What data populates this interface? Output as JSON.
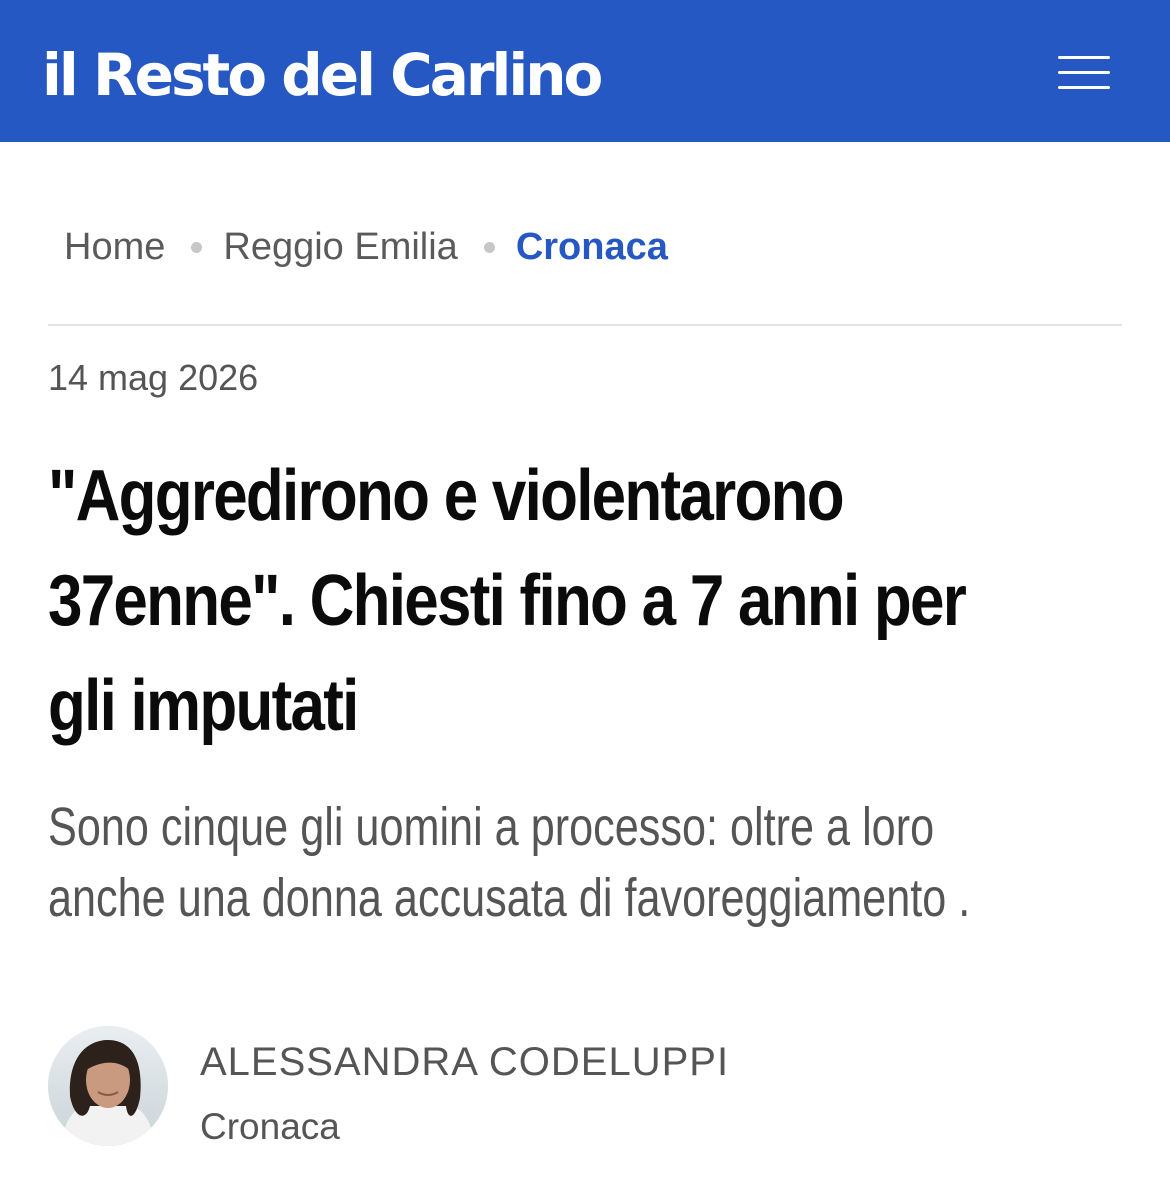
{
  "header": {
    "logo_text": "il Resto del Carlino",
    "menu_icon": "hamburger-menu-icon",
    "background_color": "#2558c3"
  },
  "breadcrumb": {
    "items": [
      {
        "label": "Home"
      },
      {
        "label": "Reggio Emilia"
      },
      {
        "label": "Cronaca"
      }
    ],
    "active_color": "#2558c3"
  },
  "article": {
    "date": "14 mag 2026",
    "headline": "\"Aggredirono e violentarono 37enne\". Chiesti fino a 7 anni per gli imputati",
    "subtitle": "Sono cinque gli uomini a processo: oltre a loro anche una donna accusata di favoreggiamento .",
    "author": {
      "name": "ALESSANDRA CODELUPPI",
      "section": "Cronaca",
      "avatar_icon": "author-photo"
    }
  }
}
